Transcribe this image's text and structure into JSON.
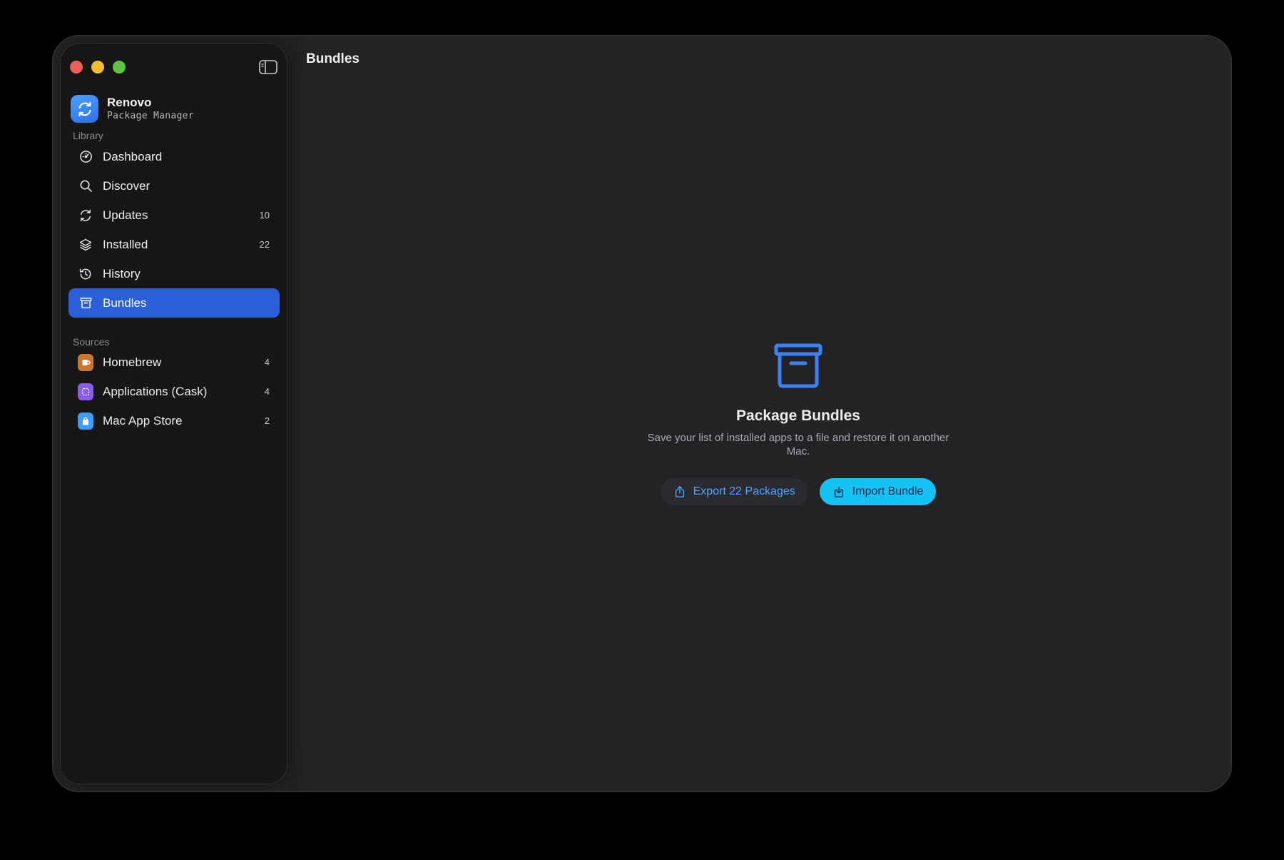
{
  "app": {
    "name": "Renovo",
    "subtitle": "Package Manager"
  },
  "sidebar": {
    "library_label": "Library",
    "library_items": [
      {
        "label": "Dashboard",
        "icon": "gauge-icon",
        "count": ""
      },
      {
        "label": "Discover",
        "icon": "search-icon",
        "count": ""
      },
      {
        "label": "Updates",
        "icon": "refresh-icon",
        "count": "10"
      },
      {
        "label": "Installed",
        "icon": "layers-icon",
        "count": "22"
      },
      {
        "label": "History",
        "icon": "history-icon",
        "count": ""
      },
      {
        "label": "Bundles",
        "icon": "archive-box-icon",
        "count": "",
        "active": true
      }
    ],
    "sources_label": "Sources",
    "source_items": [
      {
        "label": "Homebrew",
        "icon": "homebrew-icon",
        "count": "4",
        "color": "#c9772f"
      },
      {
        "label": "Applications (Cask)",
        "icon": "cask-icon",
        "count": "4",
        "color": "#8a5cf0"
      },
      {
        "label": "Mac App Store",
        "icon": "app-store-icon",
        "count": "2",
        "color": "#3d9bfa"
      }
    ]
  },
  "main": {
    "title": "Bundles",
    "empty_state": {
      "icon": "archive-box-icon",
      "title": "Package Bundles",
      "description": "Save your list of installed apps to a file and restore it on another Mac.",
      "export_label": "Export 22 Packages",
      "import_label": "Import Bundle"
    }
  },
  "colors": {
    "accent": "#2b5fd9",
    "import_button": "#14c2f5",
    "export_text": "#4ea3ff",
    "icon_blue": "#3a82f6"
  }
}
